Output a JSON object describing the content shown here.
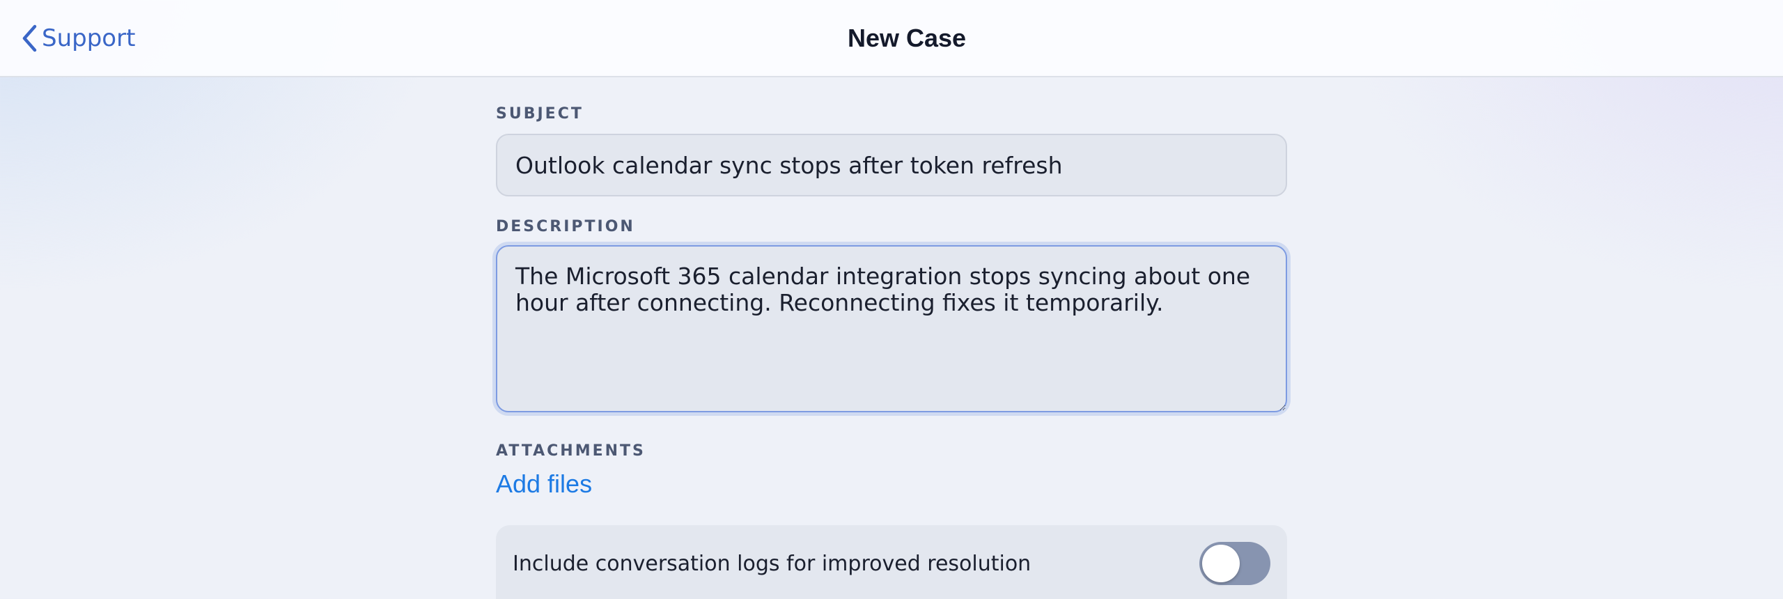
{
  "nav": {
    "back_label": "Support",
    "title": "New Case"
  },
  "form": {
    "subject": {
      "label": "SUBJECT",
      "value": "Outlook calendar sync stops after token refresh"
    },
    "description": {
      "label": "DESCRIPTION",
      "value": "The Microsoft 365 calendar integration stops syncing about one hour after connecting. Reconnecting fixes it temporarily."
    },
    "attachments": {
      "label": "ATTACHMENTS",
      "add_label": "Add files"
    },
    "logs_toggle": {
      "label": "Include conversation logs for improved resolution",
      "on": false
    }
  },
  "colors": {
    "accent": "#3a66c7",
    "link": "#1c7ae4",
    "toggle_off": "#8794b0"
  },
  "icons": {
    "back": "chevron-left-icon"
  }
}
